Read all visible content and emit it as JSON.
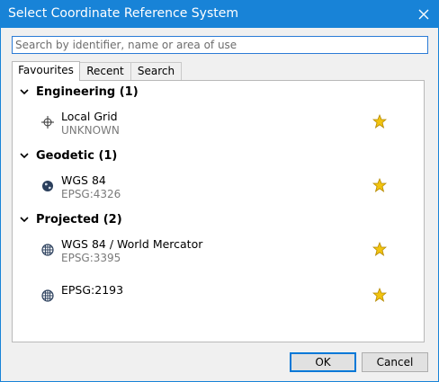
{
  "window": {
    "title": "Select Coordinate Reference System"
  },
  "search": {
    "placeholder": "Search by identifier, name or area of use",
    "value": ""
  },
  "tabs": [
    {
      "label": "Favourites",
      "active": true
    },
    {
      "label": "Recent",
      "active": false
    },
    {
      "label": "Search",
      "active": false
    }
  ],
  "groups": [
    {
      "label": "Engineering (1)",
      "expanded": true,
      "items": [
        {
          "name": "Local Grid",
          "code": "UNKNOWN",
          "icon": "crosshair-icon",
          "favourite": true
        }
      ]
    },
    {
      "label": "Geodetic (1)",
      "expanded": true,
      "items": [
        {
          "name": "WGS 84",
          "code": "EPSG:4326",
          "icon": "globe-icon",
          "favourite": true
        }
      ]
    },
    {
      "label": "Projected (2)",
      "expanded": true,
      "items": [
        {
          "name": "WGS 84 / World Mercator",
          "code": "EPSG:3395",
          "icon": "grid-globe-icon",
          "favourite": true
        },
        {
          "name": "EPSG:2193",
          "code": "",
          "icon": "grid-globe-icon",
          "favourite": true
        }
      ]
    }
  ],
  "buttons": {
    "ok": "OK",
    "cancel": "Cancel"
  },
  "colors": {
    "titlebar": "#1883d7",
    "star": "#f2c40f",
    "accent": "#0078d7"
  }
}
